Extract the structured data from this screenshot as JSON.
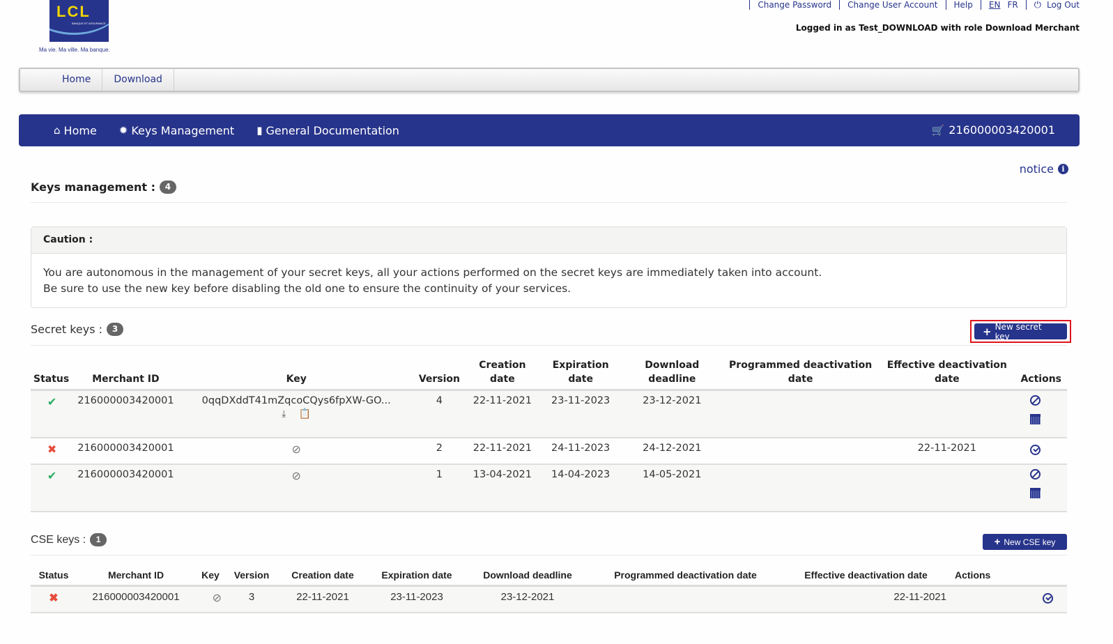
{
  "logo": {
    "letters": "LCL",
    "sub": "BANQUE ET ASSURANCE",
    "tagline": "Ma vie. Ma ville. Ma banque."
  },
  "top_links": {
    "change_password": "Change Password",
    "change_user_account": "Change User Account",
    "help": "Help",
    "lang_en": "EN",
    "lang_fr": "FR",
    "logout": "Log Out",
    "logged_in": "Logged in as Test_DOWNLOAD with role Download Merchant"
  },
  "subnav": {
    "items": [
      "Home",
      "Download"
    ]
  },
  "mainnav": {
    "home": "Home",
    "keys_management": "Keys Management",
    "general_documentation": "General Documentation",
    "merchant_id": "216000003420001"
  },
  "notice": "notice",
  "page": {
    "title": "Keys management :",
    "count": "4"
  },
  "caution": {
    "title": "Caution :",
    "line1": "You are autonomous in the management of your secret keys, all your actions performed on the secret keys are immediately taken into account.",
    "line2": "Be sure to use the new key before disabling the old one to ensure the continuity of your services."
  },
  "secret_keys": {
    "title": "Secret keys :",
    "count": "3",
    "new_button": "New secret key",
    "headers": {
      "status": "Status",
      "merchant_id": "Merchant ID",
      "key": "Key",
      "version": "Version",
      "creation_1": "Creation",
      "creation_2": "date",
      "expiration_1": "Expiration",
      "expiration_2": "date",
      "download_1": "Download",
      "download_2": "deadline",
      "programmed_1": "Programmed deactivation",
      "programmed_2": "date",
      "effective_1": "Effective deactivation",
      "effective_2": "date",
      "actions": "Actions"
    },
    "rows": [
      {
        "status": "active",
        "merchant_id": "216000003420001",
        "key": "0qqDXddT41mZqcoCQys6fpXW-GO...",
        "version": "4",
        "creation": "22-11-2021",
        "expiration": "23-11-2023",
        "download": "23-12-2021",
        "programmed": "",
        "effective": ""
      },
      {
        "status": "inactive",
        "merchant_id": "216000003420001",
        "key": "",
        "version": "2",
        "creation": "22-11-2021",
        "expiration": "24-11-2023",
        "download": "24-12-2021",
        "programmed": "",
        "effective": "22-11-2021"
      },
      {
        "status": "active",
        "merchant_id": "216000003420001",
        "key": "",
        "version": "1",
        "creation": "13-04-2021",
        "expiration": "14-04-2023",
        "download": "14-05-2021",
        "programmed": "",
        "effective": ""
      }
    ]
  },
  "cse_keys": {
    "title": "CSE keys :",
    "count": "1",
    "new_button": "New CSE key",
    "headers": {
      "status": "Status",
      "merchant_id": "Merchant ID",
      "key": "Key",
      "version": "Version",
      "creation": "Creation date",
      "expiration": "Expiration date",
      "download": "Download deadline",
      "programmed": "Programmed deactivation date",
      "effective": "Effective deactivation date",
      "actions": "Actions"
    },
    "rows": [
      {
        "status": "inactive",
        "merchant_id": "216000003420001",
        "key": "",
        "version": "3",
        "creation": "22-11-2021",
        "expiration": "23-11-2023",
        "download": "23-12-2021",
        "programmed": "",
        "effective": "22-11-2021"
      }
    ]
  },
  "colors": {
    "brand": "#27348b",
    "ok": "#27ae60",
    "ko": "#e74c3c",
    "highlight": "#e0141e",
    "logo_yellow": "#f2d600"
  }
}
